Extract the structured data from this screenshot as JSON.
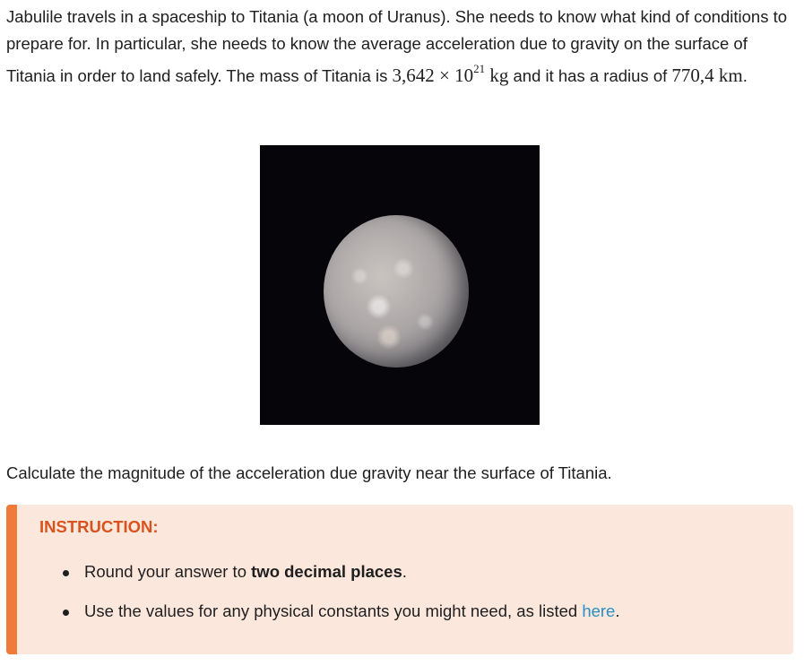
{
  "intro": {
    "part1": "Jabulile travels in a spaceship to Titania (a moon of Uranus). She needs to know what kind of conditions to prepare for. In particular, she needs to know the average acceleration due to gravity on the surface of Titania in order to land safely. The mass of Titania is ",
    "mass_mantissa": "3,642 × 10",
    "mass_exponent": "21",
    "mass_unit": " kg",
    "part2": " and it has a radius of ",
    "radius_value": "770,4 km",
    "part3": "."
  },
  "question": "Calculate the magnitude of the acceleration due gravity near the surface of Titania.",
  "instruction": {
    "title": "INSTRUCTION:",
    "items": [
      {
        "prefix": "Round your answer to ",
        "bold": "two decimal places",
        "suffix": "."
      },
      {
        "prefix": "Use the values for any physical constants you might need, as listed ",
        "link": "here",
        "suffix": "."
      }
    ]
  },
  "colors": {
    "accent": "#f07a3a",
    "title": "#d9531e",
    "box_bg": "#fce7dc",
    "link": "#2a8fc4"
  }
}
